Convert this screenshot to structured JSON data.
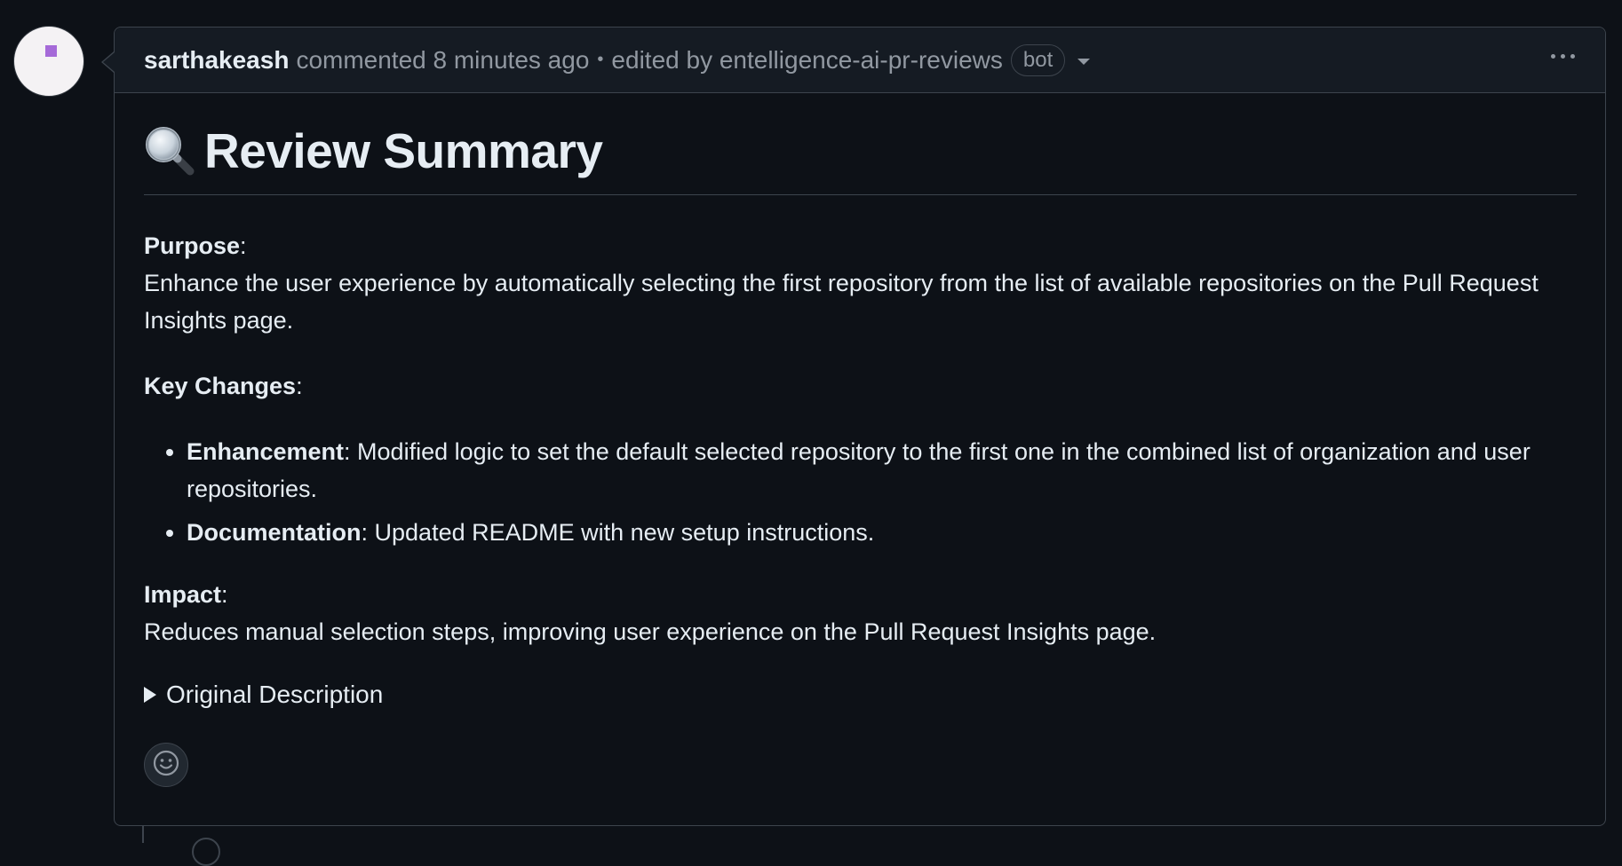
{
  "comment": {
    "author": "sarthakeash",
    "action_text": "commented 8 minutes ago",
    "separator": "•",
    "edited_text": "edited by entelligence-ai-pr-reviews",
    "badge": "bot"
  },
  "summary": {
    "title": "Review Summary",
    "icon": "magnifying-glass-icon",
    "purpose_label": "Purpose",
    "purpose_colon": ":",
    "purpose_text": "Enhance the user experience by automatically selecting the first repository from the list of available repositories on the Pull Request Insights page.",
    "key_changes_label": "Key Changes",
    "key_changes_colon": ":",
    "changes": [
      {
        "label": "Enhancement",
        "text": ": Modified logic to set the default selected repository to the first one in the combined list of organization and user repositories."
      },
      {
        "label": "Documentation",
        "text": ": Updated README with new setup instructions."
      }
    ],
    "impact_label": "Impact",
    "impact_colon": ":",
    "impact_text": "Reduces manual selection steps, improving user experience on the Pull Request Insights page.",
    "details_summary": "Original Description"
  },
  "colors": {
    "background": "#0d1117",
    "header_bg": "#151b23",
    "border": "#3d444d",
    "text": "#e6edf3",
    "muted": "#9198a1",
    "avatar_accent": "#a56ad8"
  }
}
